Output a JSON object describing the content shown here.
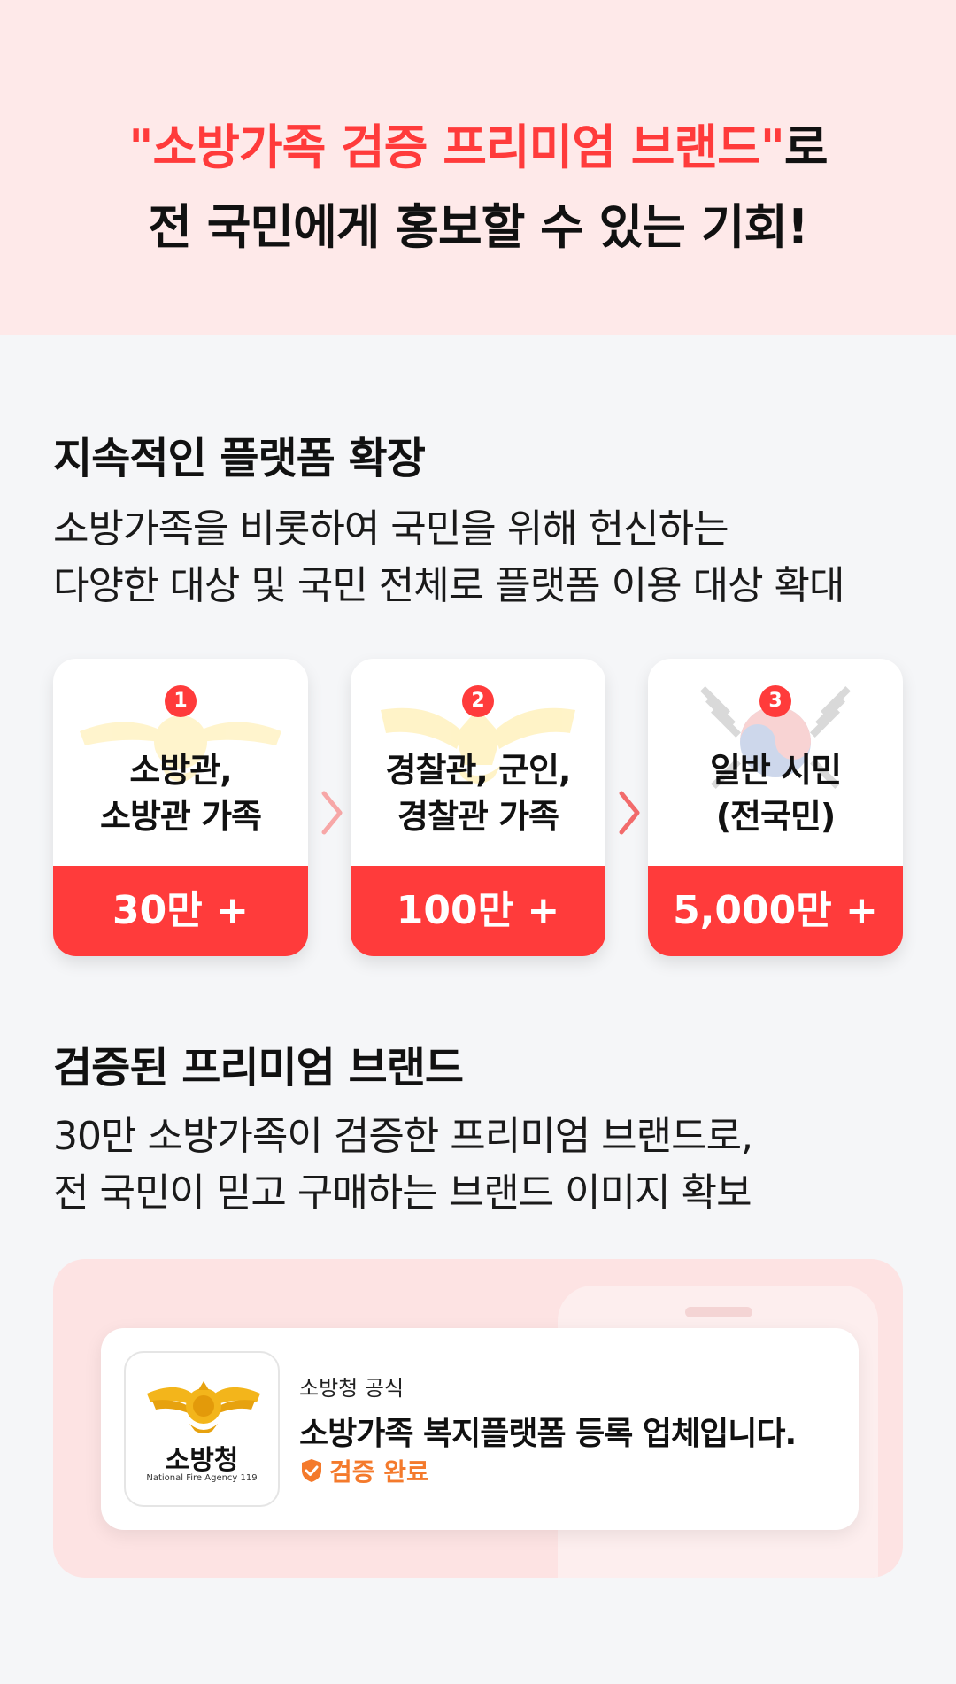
{
  "hero": {
    "line1_accent": "\"소방가족 검증 프리미엄 브랜드\"",
    "line1_rest": "로",
    "line2": "전 국민에게 홍보할 수 있는 기회!"
  },
  "expansion": {
    "title": "지속적인 플랫폼 확장",
    "desc_line1": "소방가족을 비롯하여 국민을 위해 헌신하는",
    "desc_line2": "다양한 대상 및 국민 전체로 플랫폼 이용 대상 확대",
    "cards": [
      {
        "num": "1",
        "label_line1": "소방관,",
        "label_line2": "소방관 가족",
        "count": "30만 +",
        "emblem": "fire-emblem-icon"
      },
      {
        "num": "2",
        "label_line1": "경찰관, 군인,",
        "label_line2": "경찰관 가족",
        "count": "100만 +",
        "emblem": "police-emblem-icon"
      },
      {
        "num": "3",
        "label_line1": "일반 시민",
        "label_line2": "(전국민)",
        "count": "5,000만 +",
        "emblem": "taegukgi-icon"
      }
    ]
  },
  "brand": {
    "title": "검증된 프리미엄 브랜드",
    "desc_line1": "30만 소방가족이 검증한 프리미엄 브랜드로,",
    "desc_line2": "전 국민이 믿고 구매하는 브랜드 이미지 확보"
  },
  "badge": {
    "logo_text": "소방청",
    "logo_sub": "National Fire Agency 119",
    "small": "소방청 공식",
    "main": "소방가족 복지플랫폼 등록 업체입니다.",
    "verify": "검증 완료"
  },
  "colors": {
    "accent": "#ff3b3b",
    "hero_bg": "#fee9e9",
    "verify": "#f47a2c"
  }
}
